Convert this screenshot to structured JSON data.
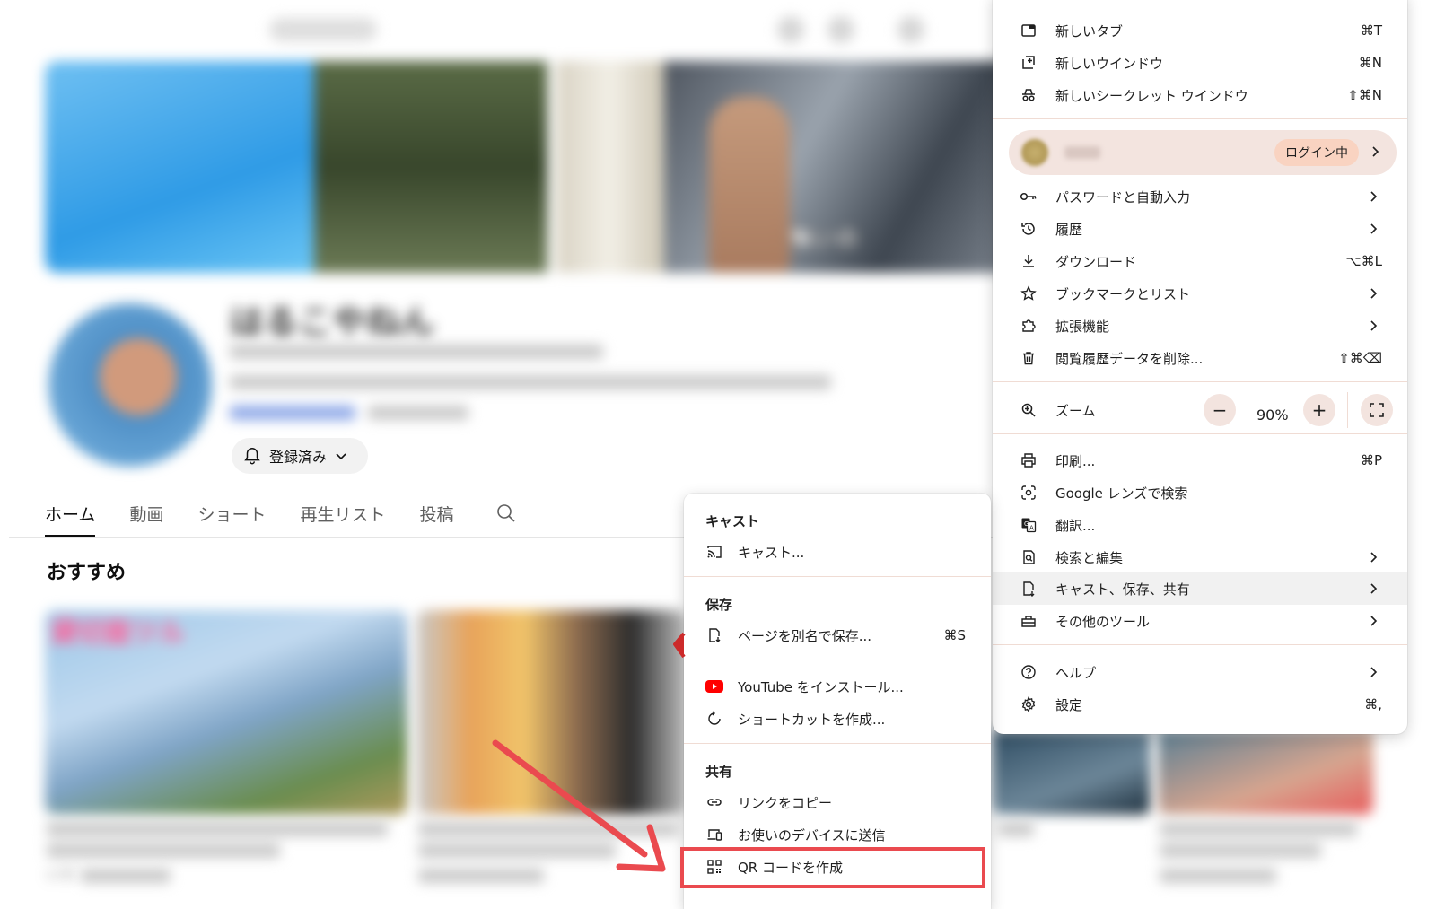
{
  "background": {
    "channel_name": "はるこやねん",
    "banner_text": "悔いの",
    "subscribe_label": "登録済み",
    "tabs": [
      "ホーム",
      "動画",
      "ショート",
      "再生リスト",
      "投稿"
    ],
    "section_title": "おすすめ",
    "thumb1_title": "貸切面ツル",
    "view_count": "1.7万"
  },
  "main_menu": {
    "items": [
      {
        "label": "新しいタブ",
        "shortcut": "⌘T",
        "icon": "new-tab-icon"
      },
      {
        "label": "新しいウインドウ",
        "shortcut": "⌘N",
        "icon": "new-window-icon"
      },
      {
        "label": "新しいシークレット ウインドウ",
        "shortcut": "⇧⌘N",
        "icon": "incognito-icon"
      }
    ],
    "profile": {
      "login_badge": "ログイン中"
    },
    "items2": [
      {
        "label": "パスワードと自動入力",
        "shortcut": "",
        "icon": "key-icon"
      },
      {
        "label": "履歴",
        "shortcut": "",
        "icon": "history-icon"
      },
      {
        "label": "ダウンロード",
        "shortcut": "⌥⌘L",
        "icon": "download-icon"
      },
      {
        "label": "ブックマークとリスト",
        "shortcut": "",
        "icon": "star-icon"
      },
      {
        "label": "拡張機能",
        "shortcut": "",
        "icon": "extension-icon"
      },
      {
        "label": "閲覧履歴データを削除...",
        "shortcut": "⇧⌘⌫",
        "icon": "trash-icon"
      }
    ],
    "zoom": {
      "label": "ズーム",
      "value": "90%",
      "minus": "−",
      "plus": "+"
    },
    "items3": [
      {
        "label": "印刷...",
        "shortcut": "⌘P",
        "icon": "print-icon"
      },
      {
        "label": "Google レンズで検索",
        "shortcut": "",
        "icon": "lens-icon"
      },
      {
        "label": "翻訳...",
        "shortcut": "",
        "icon": "translate-icon"
      },
      {
        "label": "検索と編集",
        "shortcut": "",
        "icon": "find-icon"
      },
      {
        "label": "キャスト、保存、共有",
        "shortcut": "",
        "icon": "cast-save-share-icon"
      },
      {
        "label": "その他のツール",
        "shortcut": "",
        "icon": "toolbox-icon"
      }
    ],
    "items4": [
      {
        "label": "ヘルプ",
        "shortcut": "",
        "icon": "help-icon"
      },
      {
        "label": "設定",
        "shortcut": "⌘,",
        "icon": "gear-icon"
      }
    ]
  },
  "sub_menu": {
    "cast_header": "キャスト",
    "cast_item": "キャスト...",
    "save_header": "保存",
    "save_page": "ページを別名で保存...",
    "save_page_shortcut": "⌘S",
    "install_youtube": "YouTube をインストール...",
    "create_shortcut": "ショートカットを作成...",
    "share_header": "共有",
    "copy_link": "リンクをコピー",
    "send_to_devices": "お使いのデバイスに送信",
    "create_qr": "QR コードを作成"
  },
  "colors": {
    "highlight_red": "#ea4a4f",
    "login_badge_bg": "#f9d3c1",
    "youtube_red": "#ff0000"
  }
}
